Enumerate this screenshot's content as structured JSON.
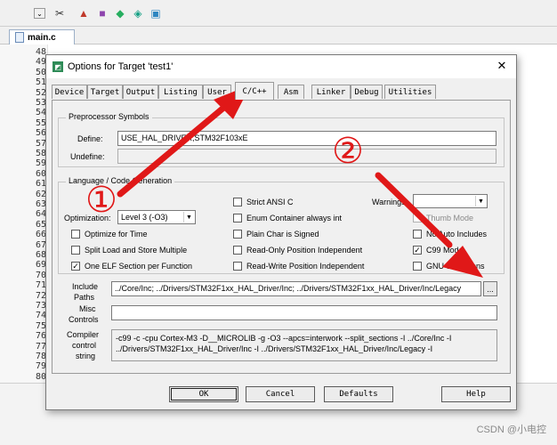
{
  "ide": {
    "file_tab": "main.c",
    "line_numbers": [
      "48",
      "49",
      "50",
      "51",
      "52",
      "53",
      "54",
      "55",
      "56",
      "57",
      "58",
      "59",
      "60",
      "61",
      "62",
      "63",
      "64",
      "65",
      "66",
      "67",
      "68",
      "69",
      "70",
      "71",
      "72",
      "73",
      "74",
      "75",
      "76",
      "77",
      "78",
      "79",
      "80"
    ]
  },
  "dialog": {
    "title": "Options for Target 'test1'",
    "tabs": [
      "Device",
      "Target",
      "Output",
      "Listing",
      "User",
      "C/C++",
      "Asm",
      "Linker",
      "Debug",
      "Utilities"
    ],
    "active_tab": "C/C++",
    "preprocessor": {
      "title": "Preprocessor Symbols",
      "define_label": "Define:",
      "define_value": "USE_HAL_DRIVER,STM32F103xE",
      "undefine_label": "Undefine:",
      "undefine_value": ""
    },
    "language": {
      "title": "Language / Code Generation",
      "optimization_label": "Optimization:",
      "optimization_value": "Level 3 (-O3)",
      "optimize_time": "Optimize for Time",
      "split_load": "Split Load and Store Multiple",
      "one_elf": "One ELF Section per Function",
      "strict_ansi": "Strict ANSI C",
      "enum_container": "Enum Container always int",
      "plain_char": "Plain Char is Signed",
      "ro_pos": "Read-Only Position Independent",
      "rw_pos": "Read-Write Position Independent",
      "warnings_label": "Warnings:",
      "warnings_value": "",
      "thumb_mode": "Thumb Mode",
      "no_auto": "No Auto Includes",
      "c99": "C99 Mode",
      "gnu_ext": "GNU extensions"
    },
    "include": {
      "label_line1": "Include",
      "label_line2": "Paths",
      "value": "../Core/Inc; ../Drivers/STM32F1xx_HAL_Driver/Inc; ../Drivers/STM32F1xx_HAL_Driver/Inc/Legacy",
      "browse": "..."
    },
    "misc": {
      "label_line1": "Misc",
      "label_line2": "Controls",
      "value": ""
    },
    "compiler": {
      "label_line1": "Compiler",
      "label_line2": "control",
      "label_line3": "string",
      "line1": "-c99 -c -cpu Cortex-M3 -D__MICROLIB -g -O3 --apcs=interwork --split_sections -I ../Core/Inc -I",
      "line2": "../Drivers/STM32F1xx_HAL_Driver/Inc -I ../Drivers/STM32F1xx_HAL_Driver/Inc/Legacy -I"
    },
    "buttons": {
      "ok": "OK",
      "cancel": "Cancel",
      "defaults": "Defaults",
      "help": "Help"
    }
  },
  "annotations": {
    "circle1": "①",
    "circle2": "②",
    "arrow_color": "#e01818"
  },
  "watermark": "CSDN @小电控"
}
